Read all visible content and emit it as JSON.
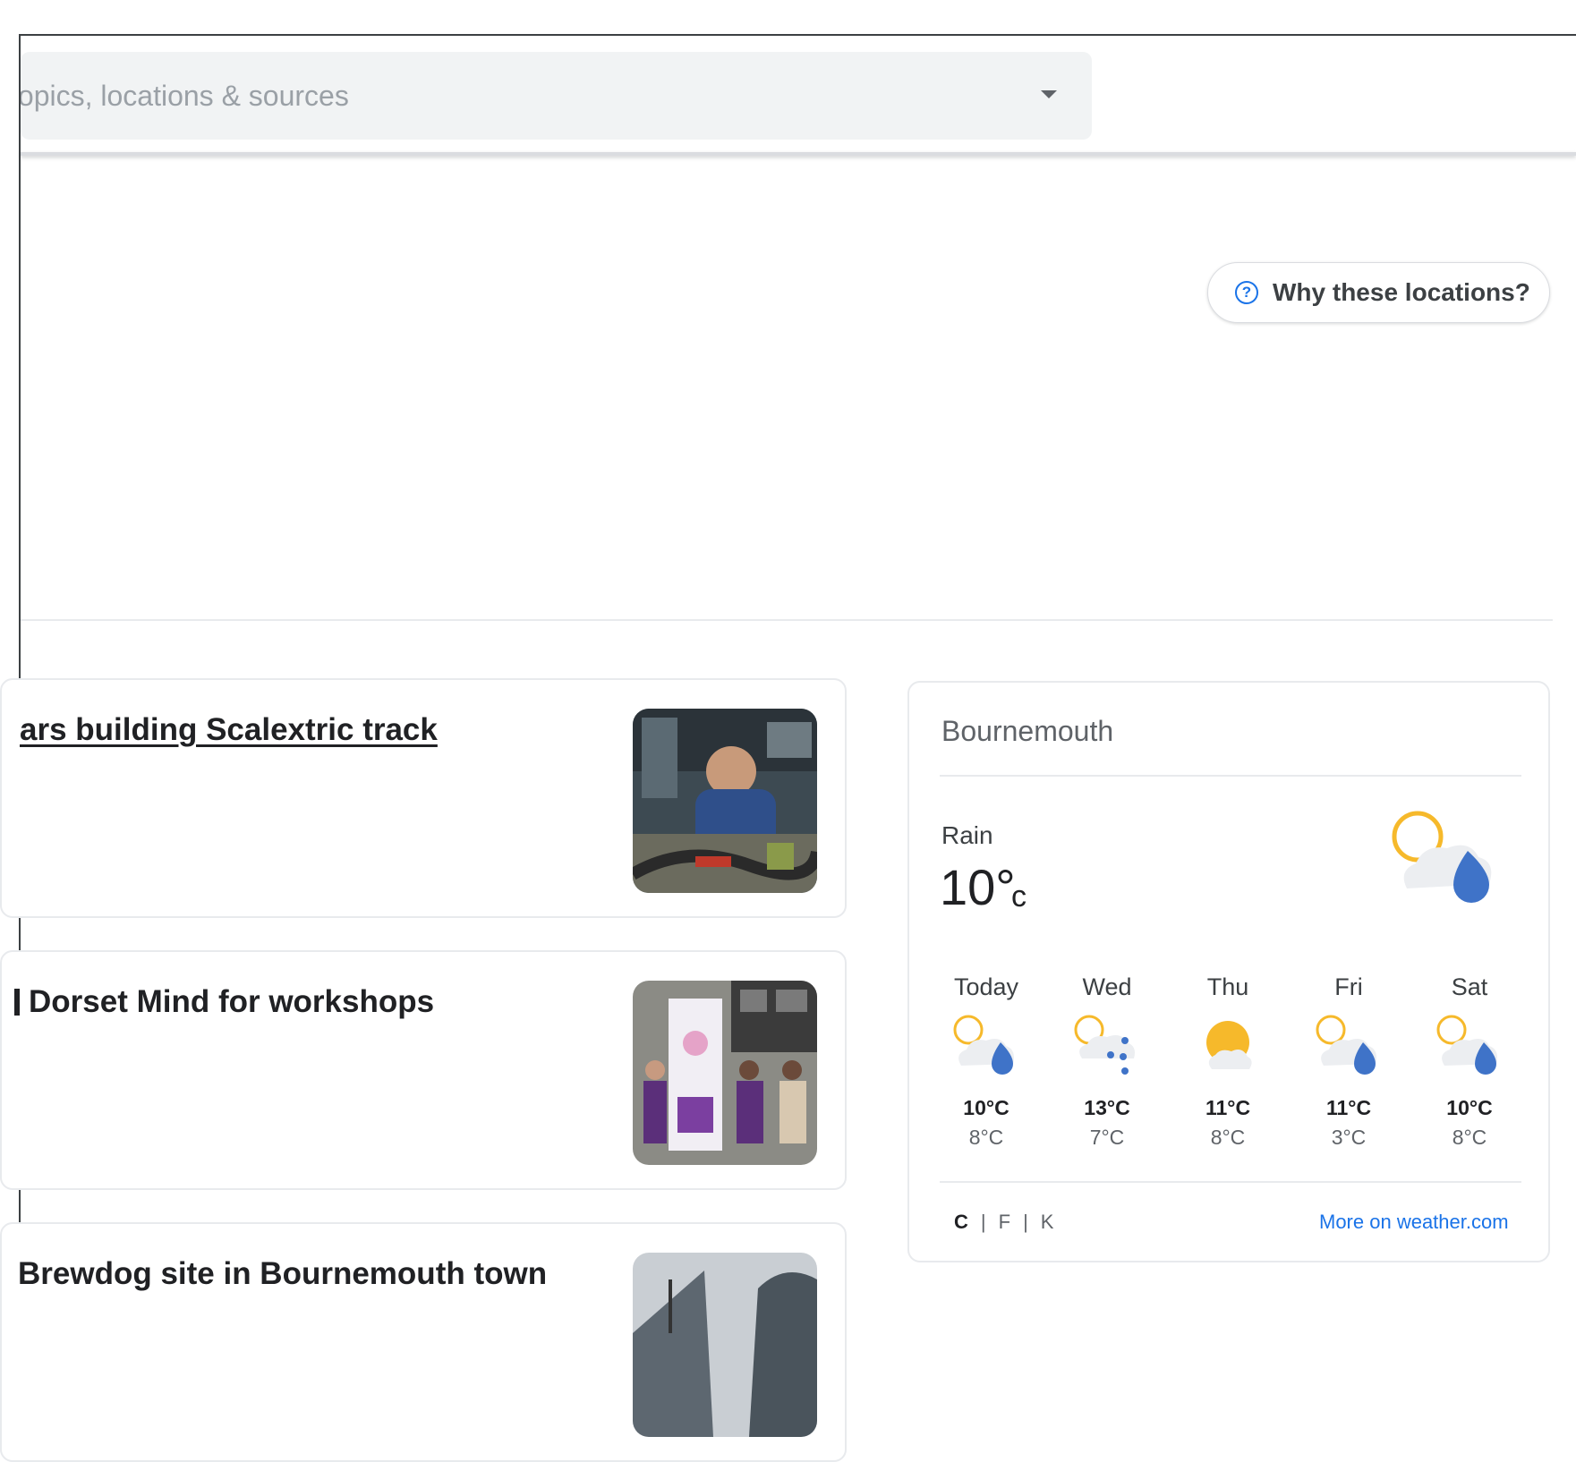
{
  "search": {
    "placeholder": "topics, locations & sources"
  },
  "locations_help": {
    "label": "Why these locations?",
    "icon": "help-circle-icon"
  },
  "articles": [
    {
      "title": "ars building Scalextric track",
      "thumbnail": "photo-man-with-scalextric-track"
    },
    {
      "title": "Dorset Mind for workshops",
      "thumbnail": "photo-group-with-banner"
    },
    {
      "title": "Brewdog site in Bournemouth town",
      "thumbnail": "photo-building"
    }
  ],
  "weather": {
    "city": "Bournemouth",
    "condition": "Rain",
    "temperature": "10°",
    "unit": "c",
    "current_icon": "sun-cloud-rain-icon",
    "forecast": [
      {
        "day": "Today",
        "icon": "sun-cloud-rain-icon",
        "high": "10°C",
        "low": "8°C"
      },
      {
        "day": "Wed",
        "icon": "sun-cloud-showers-icon",
        "high": "13°C",
        "low": "7°C"
      },
      {
        "day": "Thu",
        "icon": "sun-cloud-icon",
        "high": "11°C",
        "low": "8°C"
      },
      {
        "day": "Fri",
        "icon": "sun-cloud-rain-icon",
        "high": "11°C",
        "low": "3°C"
      },
      {
        "day": "Sat",
        "icon": "sun-cloud-rain-icon",
        "high": "10°C",
        "low": "8°C"
      }
    ],
    "units": [
      "C",
      "F",
      "K"
    ],
    "active_unit": "C",
    "more_link": "More on weather.com"
  },
  "colors": {
    "accent": "#1a73e8",
    "rain_drop": "#3f73c8",
    "sun": "#f6b92b",
    "cloud": "#e5e7ea"
  }
}
